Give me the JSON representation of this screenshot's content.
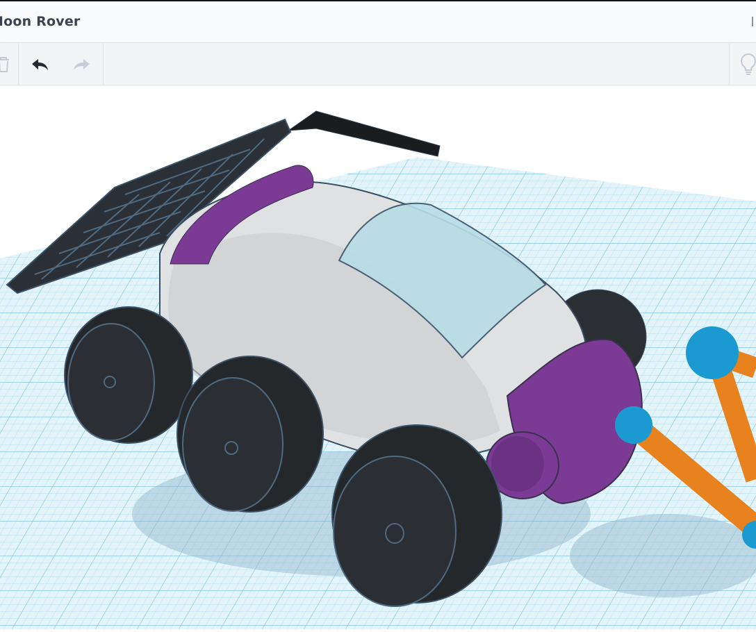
{
  "header": {
    "title": "Moon Rover"
  },
  "toolbar": {
    "delete_icon": "trash-icon",
    "undo_icon": "undo-arrow-icon",
    "redo_icon": "redo-arrow-icon",
    "hint_icon": "lightbulb-icon"
  },
  "colors": {
    "grid": "#bfe2f2",
    "workplane": "#d9f0fa",
    "wheel": "#2b2f33",
    "body": "#e4e6e8",
    "accent_purple": "#7b3a94",
    "canopy": "#b7dde6",
    "strut_orange": "#e8821e",
    "joint_blue": "#1a9ad0"
  }
}
